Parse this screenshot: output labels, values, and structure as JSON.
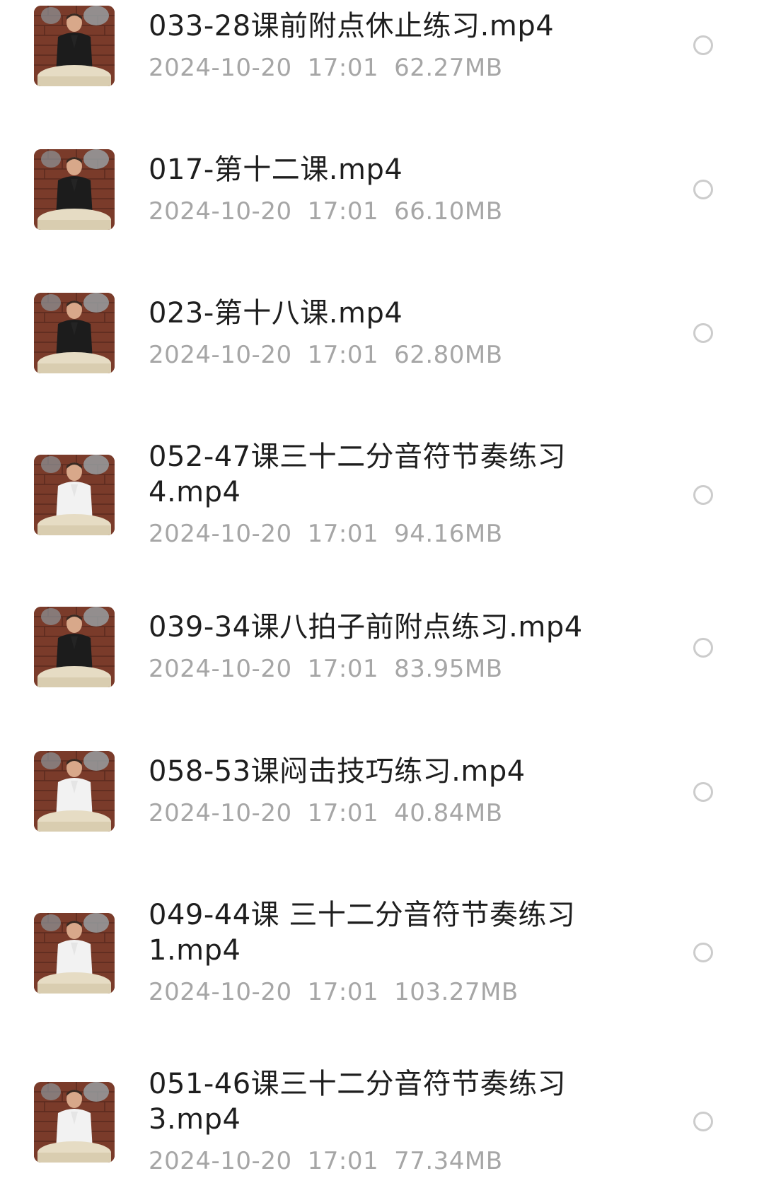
{
  "files": [
    {
      "name": "033-28课前附点休止练习.mp4",
      "date": "2024-10-20",
      "time": "17:01",
      "size": "62.27MB",
      "shirt": "#1c1c1c"
    },
    {
      "name": "017-第十二课.mp4",
      "date": "2024-10-20",
      "time": "17:01",
      "size": "66.10MB",
      "shirt": "#1c1c1c"
    },
    {
      "name": "023-第十八课.mp4",
      "date": "2024-10-20",
      "time": "17:01",
      "size": "62.80MB",
      "shirt": "#1c1c1c"
    },
    {
      "name": "052-47课三十二分音符节奏练习4.mp4",
      "date": "2024-10-20",
      "time": "17:01",
      "size": "94.16MB",
      "shirt": "#f2f2f2"
    },
    {
      "name": "039-34课八拍子前附点练习.mp4",
      "date": "2024-10-20",
      "time": "17:01",
      "size": "83.95MB",
      "shirt": "#1c1c1c"
    },
    {
      "name": "058-53课闷击技巧练习.mp4",
      "date": "2024-10-20",
      "time": "17:01",
      "size": "40.84MB",
      "shirt": "#f2f2f2"
    },
    {
      "name": "049-44课 三十二分音符节奏练习1.mp4",
      "date": "2024-10-20",
      "time": "17:01",
      "size": "103.27MB",
      "shirt": "#f2f2f2"
    },
    {
      "name": "051-46课三十二分音符节奏练习3.mp4",
      "date": "2024-10-20",
      "time": "17:01",
      "size": "77.34MB",
      "shirt": "#f2f2f2"
    }
  ],
  "icons": {
    "thumbnail": "video-thumbnail-icon",
    "select": "radio-circle-icon"
  }
}
